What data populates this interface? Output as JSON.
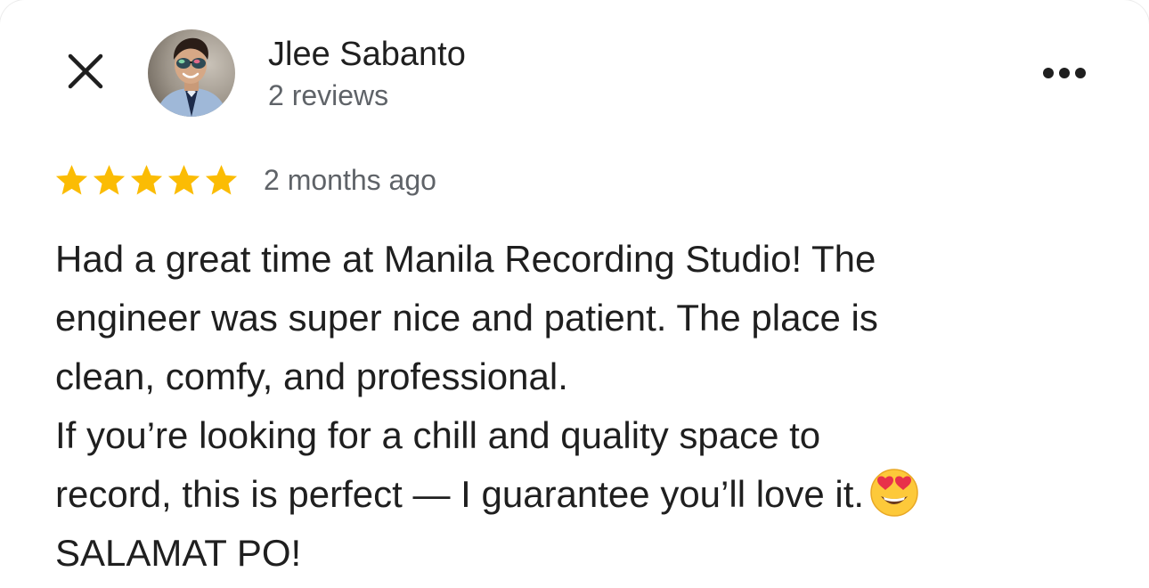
{
  "reviewer": {
    "name": "Jlee Sabanto",
    "review_count": "2 reviews",
    "avatar_icon": "person-avatar"
  },
  "review": {
    "rating": 5,
    "max_rating": 5,
    "time_ago": "2 months ago",
    "lines": [
      "Had a great time at Manila Recording Studio! The",
      "engineer was super nice and patient. The place is",
      "clean, comfy, and professional.",
      "If you’re looking for a chill and quality space to",
      "record, this is perfect — I guarantee you’ll love it.",
      "SALAMAT PO!"
    ],
    "emoji": "smiling-face-with-heart-eyes"
  },
  "icons": {
    "close": "close-icon",
    "more": "more-horizontal-icon",
    "star": "star-icon"
  },
  "colors": {
    "star": "#fbbc04",
    "text_primary": "#1f1f1f",
    "text_secondary": "#5f6368"
  }
}
